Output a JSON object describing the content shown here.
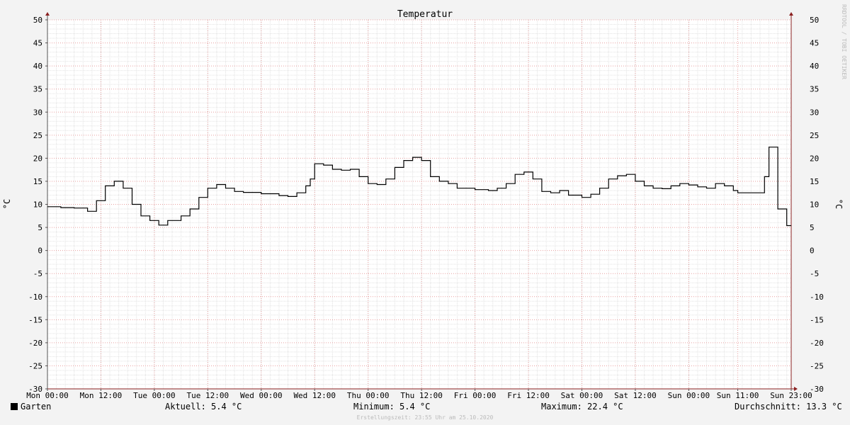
{
  "chart_data": {
    "type": "line",
    "title": "Temperatur",
    "ylabel": "°C",
    "ylim": [
      -30,
      50
    ],
    "y_ticks": [
      50,
      45,
      40,
      35,
      30,
      25,
      20,
      15,
      10,
      5,
      0,
      -5,
      -10,
      -15,
      -20,
      -25,
      -30
    ],
    "x_ticks": [
      "Mon 00:00",
      "Mon 12:00",
      "Tue 00:00",
      "Tue 12:00",
      "Wed 00:00",
      "Wed 12:00",
      "Thu 00:00",
      "Thu 12:00",
      "Fri 00:00",
      "Fri 12:00",
      "Sat 00:00",
      "Sat 12:00",
      "Sun 00:00",
      "Sun 11:00",
      "Sun 23:00"
    ],
    "grid": true,
    "series": [
      {
        "name": "Garten",
        "color": "#000000",
        "points": [
          [
            "Mon 00:00",
            9.5
          ],
          [
            "Mon 03:00",
            9.3
          ],
          [
            "Mon 06:00",
            9.2
          ],
          [
            "Mon 09:00",
            8.5
          ],
          [
            "Mon 11:00",
            10.8
          ],
          [
            "Mon 13:00",
            14.0
          ],
          [
            "Mon 15:00",
            15.0
          ],
          [
            "Mon 17:00",
            13.5
          ],
          [
            "Mon 19:00",
            10.0
          ],
          [
            "Mon 21:00",
            7.5
          ],
          [
            "Mon 23:00",
            6.5
          ],
          [
            "Tue 01:00",
            5.5
          ],
          [
            "Tue 03:00",
            6.5
          ],
          [
            "Tue 06:00",
            7.5
          ],
          [
            "Tue 08:00",
            9.0
          ],
          [
            "Tue 10:00",
            11.5
          ],
          [
            "Tue 12:00",
            13.5
          ],
          [
            "Tue 14:00",
            14.3
          ],
          [
            "Tue 16:00",
            13.5
          ],
          [
            "Tue 18:00",
            12.8
          ],
          [
            "Tue 20:00",
            12.6
          ],
          [
            "Wed 00:00",
            12.3
          ],
          [
            "Wed 04:00",
            11.9
          ],
          [
            "Wed 06:00",
            11.7
          ],
          [
            "Wed 08:00",
            12.5
          ],
          [
            "Wed 10:00",
            14.0
          ],
          [
            "Wed 11:00",
            15.5
          ],
          [
            "Wed 12:00",
            18.8
          ],
          [
            "Wed 14:00",
            18.5
          ],
          [
            "Wed 16:00",
            17.6
          ],
          [
            "Wed 18:00",
            17.4
          ],
          [
            "Wed 20:00",
            17.6
          ],
          [
            "Wed 22:00",
            16.0
          ],
          [
            "Thu 00:00",
            14.5
          ],
          [
            "Thu 02:00",
            14.3
          ],
          [
            "Thu 04:00",
            15.5
          ],
          [
            "Thu 06:00",
            18.0
          ],
          [
            "Thu 08:00",
            19.5
          ],
          [
            "Thu 10:00",
            20.2
          ],
          [
            "Thu 12:00",
            19.5
          ],
          [
            "Thu 14:00",
            16.0
          ],
          [
            "Thu 16:00",
            15.0
          ],
          [
            "Thu 18:00",
            14.5
          ],
          [
            "Thu 20:00",
            13.5
          ],
          [
            "Fri 00:00",
            13.2
          ],
          [
            "Fri 03:00",
            13.0
          ],
          [
            "Fri 05:00",
            13.5
          ],
          [
            "Fri 07:00",
            14.5
          ],
          [
            "Fri 09:00",
            16.5
          ],
          [
            "Fri 11:00",
            17.0
          ],
          [
            "Fri 13:00",
            15.5
          ],
          [
            "Fri 15:00",
            12.8
          ],
          [
            "Fri 17:00",
            12.5
          ],
          [
            "Fri 19:00",
            13.0
          ],
          [
            "Fri 21:00",
            12.0
          ],
          [
            "Sat 00:00",
            11.5
          ],
          [
            "Sat 02:00",
            12.2
          ],
          [
            "Sat 04:00",
            13.5
          ],
          [
            "Sat 06:00",
            15.5
          ],
          [
            "Sat 08:00",
            16.2
          ],
          [
            "Sat 10:00",
            16.5
          ],
          [
            "Sat 12:00",
            15.0
          ],
          [
            "Sat 14:00",
            14.0
          ],
          [
            "Sat 16:00",
            13.5
          ],
          [
            "Sat 18:00",
            13.4
          ],
          [
            "Sat 20:00",
            14.0
          ],
          [
            "Sat 22:00",
            14.5
          ],
          [
            "Sun 00:00",
            14.2
          ],
          [
            "Sun 02:00",
            13.8
          ],
          [
            "Sun 04:00",
            13.5
          ],
          [
            "Sun 06:00",
            14.5
          ],
          [
            "Sun 08:00",
            14.0
          ],
          [
            "Sun 10:00",
            13.0
          ],
          [
            "Sun 11:00",
            12.5
          ],
          [
            "Sun 16:00",
            12.5
          ],
          [
            "Sun 17:00",
            16.0
          ],
          [
            "Sun 18:00",
            22.4
          ],
          [
            "Sun 19:00",
            22.4
          ],
          [
            "Sun 20:00",
            9.0
          ],
          [
            "Sun 22:00",
            5.4
          ],
          [
            "Sun 23:00",
            5.4
          ]
        ]
      }
    ],
    "watermark": "RRDTOOL / TOBI OETIKER"
  },
  "legend": {
    "series_name": "Garten",
    "current": "Aktuell: 5.4 °C",
    "minimum": "Minimum: 5.4 °C",
    "maximum": "Maximum: 22.4 °C",
    "average": "Durchschnitt: 13.3 °C"
  },
  "footer": "Erstellungszeit: 23:55 Uhr am 25.10.2020"
}
